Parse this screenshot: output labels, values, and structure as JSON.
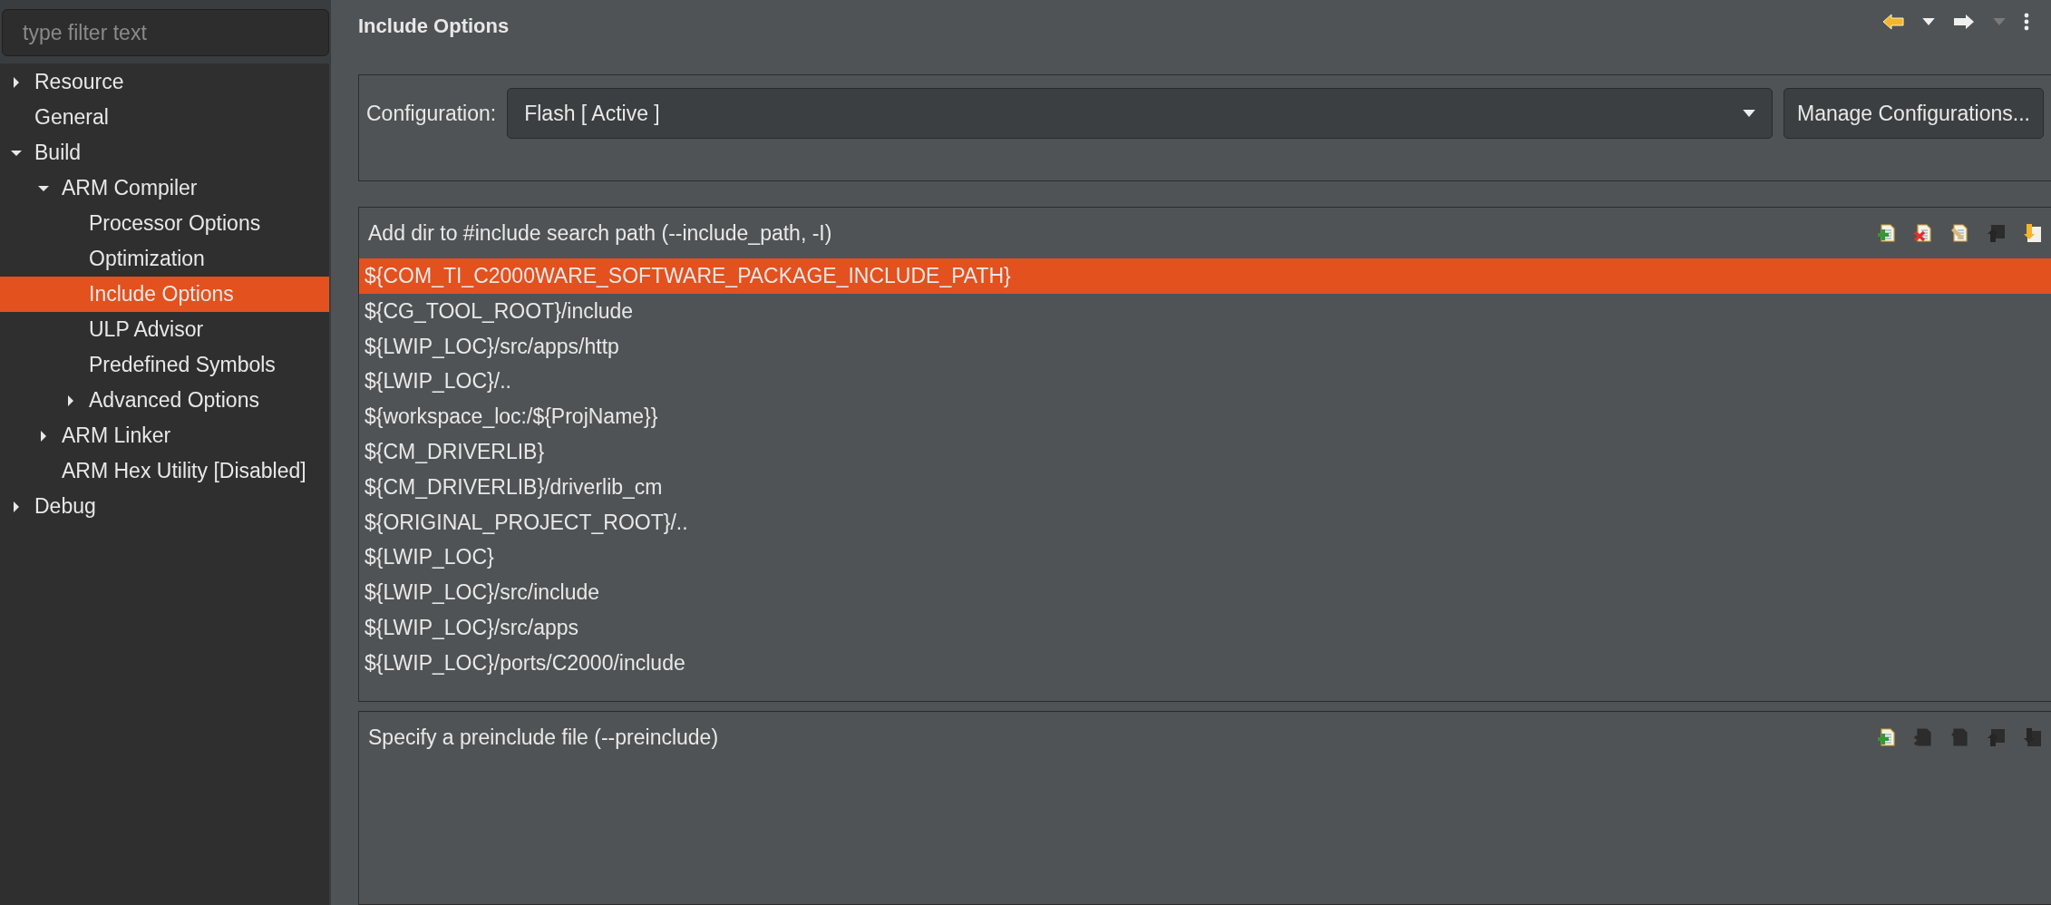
{
  "filter": {
    "placeholder": "type filter text"
  },
  "tree": [
    {
      "label": "Resource",
      "expanded": false,
      "selected": false
    },
    {
      "label": "General",
      "selected": false
    },
    {
      "label": "Build",
      "expanded": true,
      "selected": false,
      "children": [
        {
          "label": "ARM Compiler",
          "expanded": true,
          "selected": false,
          "children": [
            {
              "label": "Processor Options",
              "selected": false
            },
            {
              "label": "Optimization",
              "selected": false
            },
            {
              "label": "Include Options",
              "selected": true
            },
            {
              "label": "ULP Advisor",
              "selected": false
            },
            {
              "label": "Predefined Symbols",
              "selected": false
            },
            {
              "label": "Advanced Options",
              "expanded": false,
              "selected": false
            }
          ]
        },
        {
          "label": "ARM Linker",
          "expanded": false,
          "selected": false
        },
        {
          "label": "ARM Hex Utility  [Disabled]",
          "selected": false
        }
      ]
    },
    {
      "label": "Debug",
      "expanded": false,
      "selected": false
    }
  ],
  "page_title": "Include Options",
  "nav": [
    {
      "kind": "back",
      "disabled": false
    },
    {
      "kind": "menu",
      "disabled": false
    },
    {
      "kind": "forward",
      "disabled": false
    },
    {
      "kind": "menu",
      "disabled": true
    },
    {
      "kind": "more",
      "disabled": false
    }
  ],
  "configuration": {
    "label": "Configuration:",
    "value": "Flash  [ Active ]",
    "button": "Manage Configurations..."
  },
  "lists": [
    {
      "title": "Add dir to #include search path (--include_path, -I)",
      "tools": [
        {
          "kind": "add",
          "disabled": false
        },
        {
          "kind": "delete",
          "disabled": false
        },
        {
          "kind": "edit",
          "disabled": false
        },
        {
          "kind": "up",
          "disabled": true
        },
        {
          "kind": "down",
          "disabled": false
        }
      ],
      "items": [
        {
          "text": "${COM_TI_C2000WARE_SOFTWARE_PACKAGE_INCLUDE_PATH}",
          "selected": true
        },
        {
          "text": "${CG_TOOL_ROOT}/include",
          "selected": false
        },
        {
          "text": "${LWIP_LOC}/src/apps/http",
          "selected": false
        },
        {
          "text": "${LWIP_LOC}/..",
          "selected": false
        },
        {
          "text": "${workspace_loc:/${ProjName}}",
          "selected": false
        },
        {
          "text": "${CM_DRIVERLIB}",
          "selected": false
        },
        {
          "text": "${CM_DRIVERLIB}/driverlib_cm",
          "selected": false
        },
        {
          "text": "${ORIGINAL_PROJECT_ROOT}/..",
          "selected": false
        },
        {
          "text": "${LWIP_LOC}",
          "selected": false
        },
        {
          "text": "${LWIP_LOC}/src/include",
          "selected": false
        },
        {
          "text": "${LWIP_LOC}/src/apps",
          "selected": false
        },
        {
          "text": "${LWIP_LOC}/ports/C2000/include",
          "selected": false
        }
      ]
    },
    {
      "title": "Specify a preinclude file (--preinclude)",
      "tools": [
        {
          "kind": "add",
          "disabled": false
        },
        {
          "kind": "delete",
          "disabled": true
        },
        {
          "kind": "edit",
          "disabled": true
        },
        {
          "kind": "up",
          "disabled": true
        },
        {
          "kind": "down",
          "disabled": true
        }
      ]
    }
  ]
}
